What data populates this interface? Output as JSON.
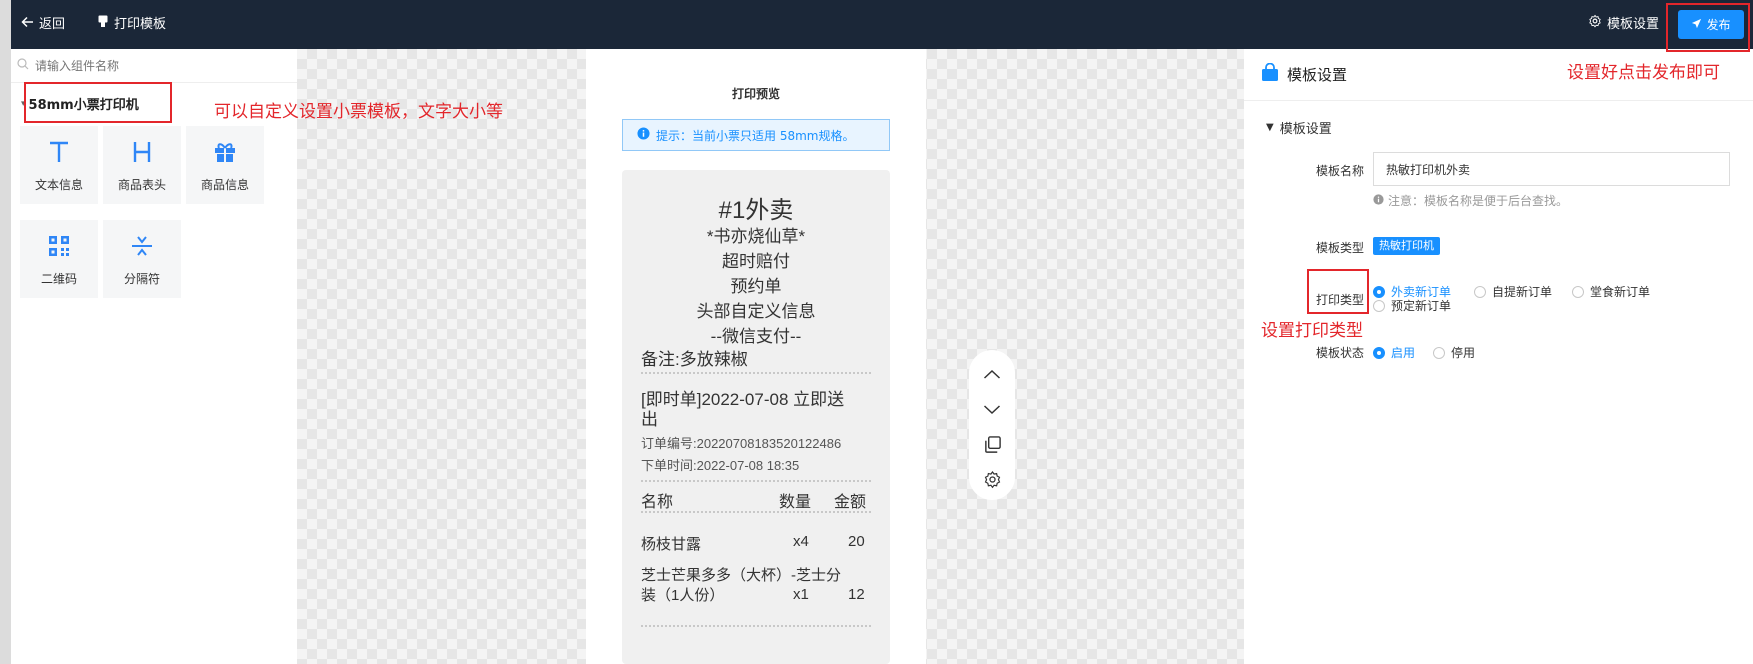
{
  "topbar": {
    "back_label": "返回",
    "page_label": "打印模板",
    "settings_label": "模板设置",
    "publish_label": "发布"
  },
  "left_panel": {
    "search_placeholder": "请输入组件名称",
    "group_title": "58mm小票打印机",
    "components": [
      {
        "label": "文本信息",
        "icon": "text-icon"
      },
      {
        "label": "商品表头",
        "icon": "heading-icon"
      },
      {
        "label": "商品信息",
        "icon": "gift-icon"
      },
      {
        "label": "二维码",
        "icon": "qrcode-icon"
      },
      {
        "label": "分隔符",
        "icon": "divider-icon"
      }
    ]
  },
  "annotations": {
    "left": "可以自定义设置小票模板，文字大小等",
    "publish": "设置好点击发布即可",
    "print_type": "设置打印类型"
  },
  "preview": {
    "title": "打印预览",
    "tip": "提示：当前小票只适用 58mm规格。",
    "receipt": {
      "order_no": "#1外卖",
      "shop": "*书亦烧仙草*",
      "compensation": "超时赔付",
      "reservation": "预约单",
      "header_custom": "头部自定义信息",
      "payment": "--微信支付--",
      "remark": "备注:多放辣椒",
      "delivery_line1": "[即时单]2022-07-08 立即送",
      "delivery_line2": "出",
      "order_number": "订单编号:20220708183520122486",
      "order_time": "下单时间:2022-07-08 18:35",
      "columns": {
        "name": "名称",
        "qty": "数量",
        "amount": "金额"
      },
      "items": [
        {
          "name": "杨枝甘露",
          "qty": "x4",
          "amount": "20"
        },
        {
          "name_line1": "芝士芒果多多（大杯）-芝士分",
          "name_line2": "装（1人份）",
          "qty": "x1",
          "amount": "12"
        }
      ]
    }
  },
  "right_panel": {
    "title": "模板设置",
    "section": "模板设置",
    "name_label": "模板名称",
    "name_value": "热敏打印机外卖",
    "name_note": "注意：模板名称是便于后台查找。",
    "type_label": "模板类型",
    "type_tag": "热敏打印机",
    "print_type_label": "打印类型",
    "print_type_options": [
      "外卖新订单",
      "自提新订单",
      "堂食新订单",
      "预定新订单"
    ],
    "status_label": "模板状态",
    "status_options": [
      "启用",
      "停用"
    ]
  },
  "colors": {
    "accent": "#1890ff",
    "topbar_bg": "#1b2738",
    "annotation_red": "#e3262b"
  }
}
